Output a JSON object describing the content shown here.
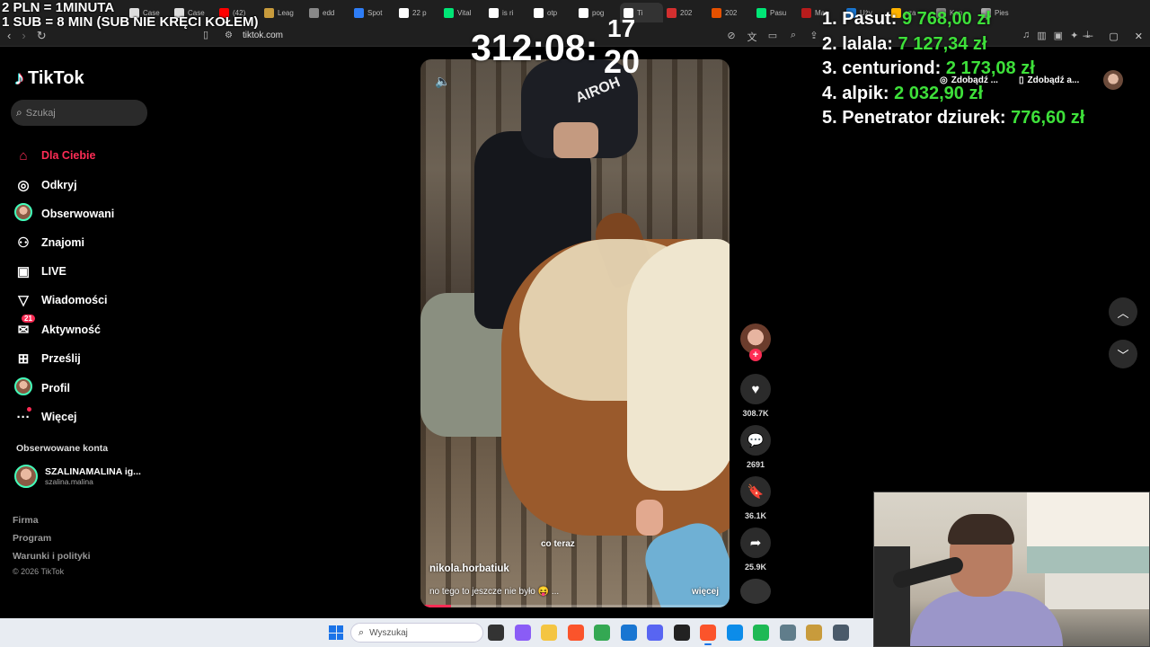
{
  "overlay": {
    "line1": "2 PLN = 1MINUTA",
    "line2": "1 SUB = 8 MIN (SUB NIE KRĘCI KOŁEM)",
    "timer": "312:08:",
    "timer_small_a": "17",
    "timer_small_b": "20"
  },
  "leaderboard": [
    {
      "rank": "1.",
      "name": "Pasut:",
      "amount": "9 768,00 zł"
    },
    {
      "rank": "2.",
      "name": "lalala:",
      "amount": "7 127,34 zł"
    },
    {
      "rank": "3.",
      "name": "centuriond:",
      "amount": "2 173,08 zł"
    },
    {
      "rank": "4.",
      "name": "alpik:",
      "amount": "2 032,90 zł"
    },
    {
      "rank": "5.",
      "name": "Penetrator dziurek:",
      "amount": "776,60 zł"
    }
  ],
  "browser": {
    "url": "tiktok.com",
    "tabs": [
      {
        "label": "Case",
        "color": "#ddd"
      },
      {
        "label": "Case",
        "color": "#ddd"
      },
      {
        "label": "(42)",
        "color": "#ff0000"
      },
      {
        "label": "Leag",
        "color": "#c89b3c"
      },
      {
        "label": "edd",
        "color": "#888"
      },
      {
        "label": "Spot",
        "color": "#2e7df6"
      },
      {
        "label": "22 p",
        "color": "#fff"
      },
      {
        "label": "Vital",
        "color": "#00e676"
      },
      {
        "label": "is ri",
        "color": "#fff"
      },
      {
        "label": "otp",
        "color": "#fff"
      },
      {
        "label": "pog",
        "color": "#fff"
      },
      {
        "label": "Ti",
        "color": "#fff",
        "active": true
      },
      {
        "label": "202",
        "color": "#d32f2f"
      },
      {
        "label": "202",
        "color": "#e65100"
      },
      {
        "label": "Pasu",
        "color": "#00e676"
      },
      {
        "label": "Mar",
        "color": "#b71c1c"
      },
      {
        "label": "Uży",
        "color": "#1976d2"
      },
      {
        "label": "sza",
        "color": "#ffb300"
      },
      {
        "label": "Kon",
        "color": "#888"
      },
      {
        "label": "Pies",
        "color": "#aaa"
      }
    ],
    "pill1": "Zdobądź ...",
    "pill2": "Zdobądź a..."
  },
  "tiktok": {
    "logo": "TikTok",
    "search_placeholder": "Szukaj",
    "nav": [
      {
        "label": "Dla Ciebie",
        "icon": "home-icon"
      },
      {
        "label": "Odkryj",
        "icon": "compass-icon"
      },
      {
        "label": "Obserwowani",
        "icon": "avatar"
      },
      {
        "label": "Znajomi",
        "icon": "friends-icon"
      },
      {
        "label": "LIVE",
        "icon": "live-icon"
      },
      {
        "label": "Wiadomości",
        "icon": "send-icon"
      },
      {
        "label": "Aktywność",
        "icon": "activity-icon",
        "badge": "21"
      },
      {
        "label": "Prześlij",
        "icon": "upload-icon"
      },
      {
        "label": "Profil",
        "icon": "avatar"
      },
      {
        "label": "Więcej",
        "icon": "more-icon"
      }
    ],
    "following_title": "Obserwowane konta",
    "following_account": {
      "name": "SZALINAMALINA ig...",
      "handle": "szalina.malina"
    },
    "footer": [
      "Firma",
      "Program",
      "Warunki i polityki"
    ],
    "copyright": "© 2026 TikTok"
  },
  "video": {
    "helmet_brand": "AIROH",
    "caption_center": "co teraz",
    "author": "nikola.horbatiuk",
    "description": "no tego to jeszcze nie było 😝 ...",
    "more": "więcej",
    "progress": 0.1,
    "likes": "308.7K",
    "comments": "2691",
    "saves": "36.1K",
    "shares": "25.9K"
  },
  "taskbar": {
    "search_placeholder": "Wyszukaj",
    "apps": [
      {
        "name": "task-view-icon",
        "color": "#333"
      },
      {
        "name": "copilot-icon",
        "color": "#8a5cf6"
      },
      {
        "name": "file-explorer-icon",
        "color": "#f4c542"
      },
      {
        "name": "brave-icon",
        "color": "#fb542b"
      },
      {
        "name": "chrome-icon",
        "color": "#34a853"
      },
      {
        "name": "store-icon",
        "color": "#1976d2"
      },
      {
        "name": "discord-icon",
        "color": "#5865f2"
      },
      {
        "name": "app-icon",
        "color": "#222"
      },
      {
        "name": "brave-active-icon",
        "color": "#fb542b",
        "active": true
      },
      {
        "name": "edge-icon",
        "color": "#0c8ce9"
      },
      {
        "name": "spotify-icon",
        "color": "#1db954"
      },
      {
        "name": "settings-icon",
        "color": "#607d8b"
      },
      {
        "name": "league-icon",
        "color": "#c89b3c"
      },
      {
        "name": "calculator-icon",
        "color": "#4a5a6a"
      }
    ]
  }
}
